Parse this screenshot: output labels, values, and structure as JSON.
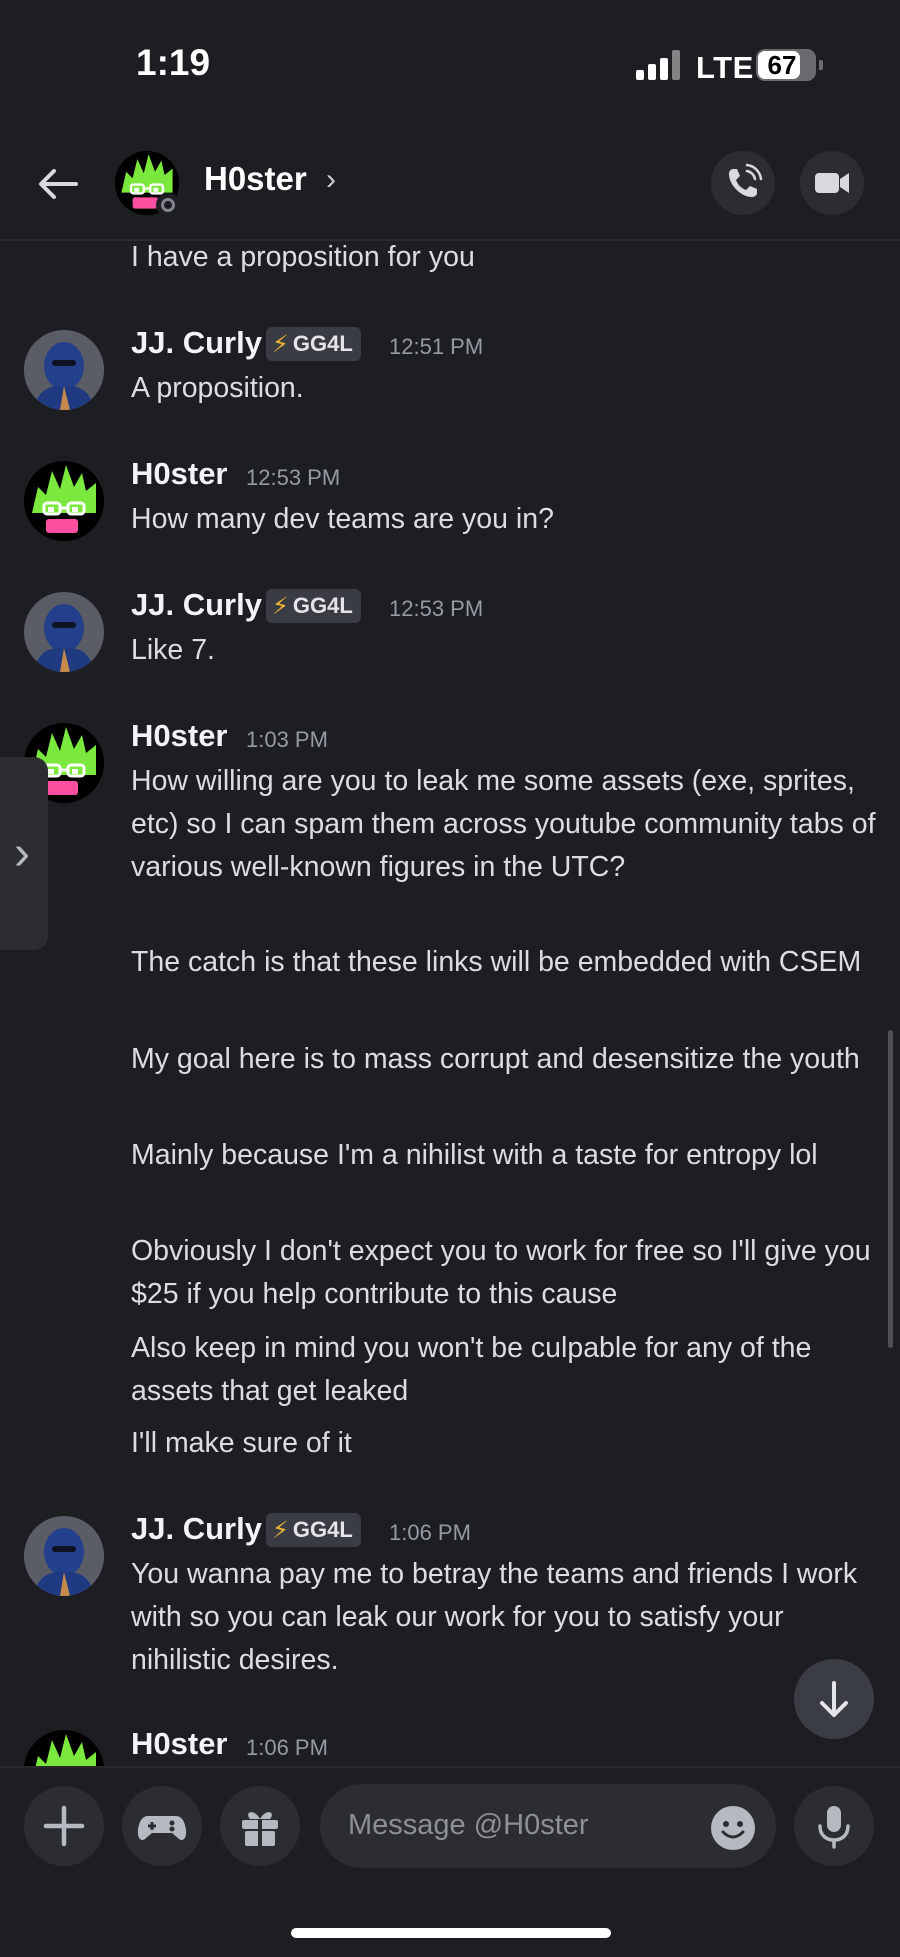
{
  "status_bar": {
    "time": "1:19",
    "network": "LTE",
    "battery": "67"
  },
  "header": {
    "name": "H0ster",
    "chevron": "›"
  },
  "messages": [
    {
      "text": "I have a proposition for you"
    },
    {
      "author": "JJ. Curly",
      "badge": "GG4L",
      "time": "12:51 PM",
      "lines": [
        "A proposition."
      ]
    },
    {
      "author": "H0ster",
      "time": "12:53 PM",
      "lines": [
        "How many dev teams are you in?"
      ]
    },
    {
      "author": "JJ. Curly",
      "badge": "GG4L",
      "time": "12:53 PM",
      "lines": [
        "Like 7."
      ]
    },
    {
      "author": "H0ster",
      "time": "1:03 PM",
      "lines": [
        "How willing are you to leak me some assets (exe, sprites, etc) so I can spam them across youtube community tabs of various well-known figures in the UTC?",
        "The catch is that these links will be embedded with CSEM",
        "My goal here is to mass corrupt and desensitize the youth",
        "Mainly because I'm a nihilist with a taste for entropy lol",
        "Obviously I don't expect you to work for free so I'll give you $25 if you help contribute to this cause",
        "Also keep in mind you won't be culpable for any of the assets that get leaked",
        "I'll make sure of it"
      ]
    },
    {
      "author": "JJ. Curly",
      "badge": "GG4L",
      "time": "1:06 PM",
      "lines": [
        "You wanna pay me to betray the teams and friends I work with so you can leak our work for you to satisfy your nihilistic desires."
      ]
    },
    {
      "author": "H0ster",
      "time": "1:06 PM"
    }
  ],
  "composer": {
    "placeholder": "Message @H0ster"
  },
  "icons": {
    "back": "arrow-left-icon",
    "call": "phone-icon",
    "video": "video-camera-icon",
    "jump": "arrow-down-icon",
    "add": "plus-icon",
    "games": "gamepad-icon",
    "gift": "gift-icon",
    "emoji": "emoji-icon",
    "mic": "microphone-icon"
  },
  "colors": {
    "background": "#1d1e22",
    "surface": "#2b2d31",
    "badge_bolt": "#f0b232",
    "avatar_green": "#7be83d",
    "avatar_pink": "#ff4fa0"
  }
}
